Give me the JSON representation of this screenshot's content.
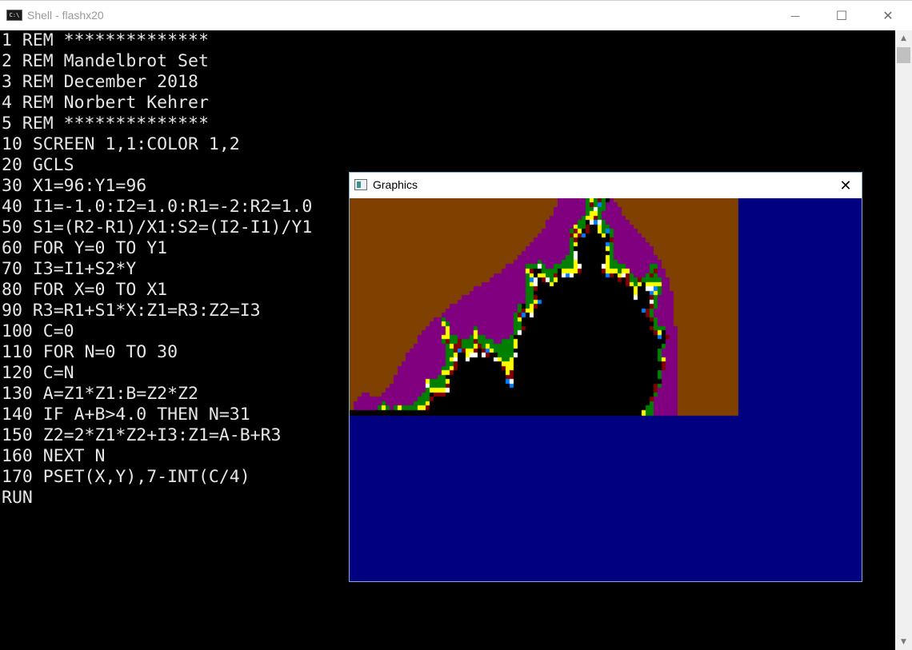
{
  "window": {
    "title": "Shell - flashx20",
    "icon": "console-app-icon",
    "icon_text": "C:\\",
    "controls": {
      "minimize": "—",
      "maximize": "☐",
      "close": "✕"
    }
  },
  "console": {
    "lines": [
      "1 REM **************",
      "2 REM Mandelbrot Set",
      "3 REM December 2018",
      "4 REM Norbert Kehrer",
      "5 REM **************",
      "10 SCREEN 1,1:COLOR 1,2",
      "20 GCLS",
      "30 X1=96:Y1=96",
      "40 I1=-1.0:I2=1.0:R1=-2:R2=1.0",
      "50 S1=(R2-R1)/X1:S2=(I2-I1)/Y1",
      "60 FOR Y=0 TO Y1",
      "70 I3=I1+S2*Y",
      "80 FOR X=0 TO X1",
      "90 R3=R1+S1*X:Z1=R3:Z2=I3",
      "100 C=0",
      "110 FOR N=0 TO 30",
      "120 C=N",
      "130 A=Z1*Z1:B=Z2*Z2",
      "140 IF A+B>4.0 THEN N=31",
      "150 Z2=2*Z1*Z2+I3:Z1=A-B+R3",
      "160 NEXT N",
      "170 PSET(X,Y),7-INT(C/4)",
      "RUN"
    ]
  },
  "scrollbar": {
    "up_arrow": "▲",
    "down_arrow": "▼"
  },
  "graphics_window": {
    "title": "Graphics",
    "icon": "graphics-window-icon",
    "close": "✕"
  },
  "mandelbrot": {
    "grid_cols": 97,
    "grid_rows": 49,
    "r_min": -2.0,
    "r_max": 1.0,
    "i_min": -1.0,
    "i_max": 0.0,
    "max_iter": 30,
    "background_color": "#000080",
    "palette": {
      "0": "#000000",
      "1": "#0080FF",
      "2": "#FFFFFF",
      "3": "#800000",
      "4": "#FFFF00",
      "5": "#008000",
      "6": "#800080",
      "7": "#804000"
    }
  }
}
